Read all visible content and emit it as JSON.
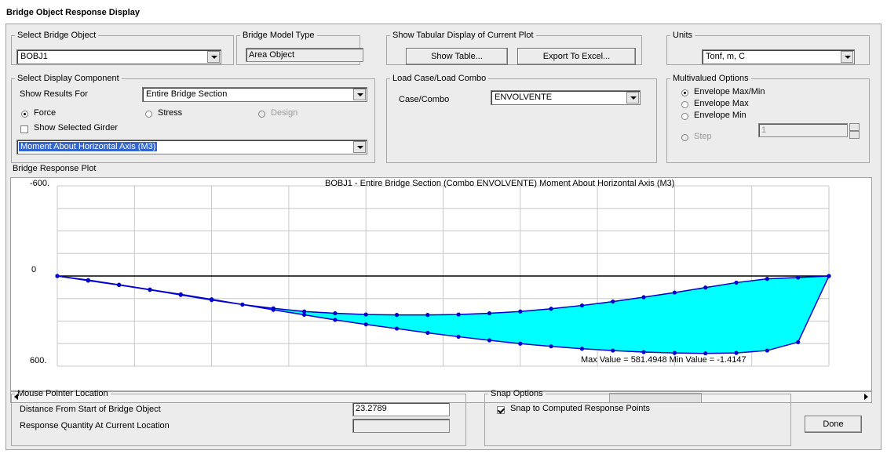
{
  "window": {
    "title": "Bridge Object Response Display"
  },
  "select_bridge_object": {
    "legend": "Select Bridge Object",
    "value": "BOBJ1"
  },
  "bridge_model_type": {
    "legend": "Bridge Model Type",
    "value": "Area Object"
  },
  "tabular": {
    "legend": "Show Tabular Display of Current Plot",
    "show_table": "Show Table...",
    "export": "Export To Excel..."
  },
  "units": {
    "legend": "Units",
    "value": "Tonf, m, C"
  },
  "display_component": {
    "legend": "Select Display Component",
    "show_results_label": "Show Results For",
    "show_results_value": "Entire Bridge Section",
    "force": "Force",
    "stress": "Stress",
    "design": "Design",
    "show_selected_girder": "Show Selected Girder",
    "component_value": "Moment About Horizontal Axis  (M3)"
  },
  "load_case": {
    "legend": "Load Case/Load Combo",
    "label": "Case/Combo",
    "value": "ENVOLVENTE"
  },
  "multivalued": {
    "legend": "Multivalued Options",
    "opt1": "Envelope Max/Min",
    "opt2": "Envelope Max",
    "opt3": "Envelope Min",
    "opt4": "Step",
    "step_value": "1",
    "selected": "Envelope Max/Min"
  },
  "plot": {
    "legend": "Bridge Response Plot",
    "header": "BOBJ1 - Entire Bridge Section  (Combo ENVOLVENTE)  Moment About Horizontal Axis  (M3)",
    "y_top": "-600.",
    "y_mid": "0",
    "y_bottom": "600.",
    "footer": "Max Value = 581.4948    Min Value = -1.4147",
    "fill_color": "#00ffff",
    "line_color": "#0000cc"
  },
  "chart_data": {
    "type": "area",
    "ylim": [
      -600,
      600
    ],
    "y_inverted": true,
    "x": [
      0,
      1,
      2,
      3,
      4,
      5,
      6,
      7,
      8,
      9,
      10,
      11,
      12,
      13,
      14,
      15,
      16,
      17,
      18,
      19,
      20,
      21,
      22,
      23,
      24,
      25
    ],
    "series": [
      {
        "values": [
          0,
          27,
          58,
          90,
          122,
          155,
          190,
          225,
          258,
          292,
          322,
          350,
          378,
          404,
          428,
          450,
          468,
          484,
          496,
          506,
          512,
          515,
          512,
          496,
          440,
          0
        ]
      },
      {
        "values": [
          0,
          31,
          60,
          92,
          126,
          160,
          190,
          215,
          236,
          248,
          256,
          259,
          259,
          256,
          248,
          236,
          218,
          196,
          170,
          141,
          110,
          77,
          44,
          19,
          10,
          0
        ]
      }
    ]
  },
  "mouse_pointer": {
    "legend": "Mouse Pointer Location",
    "distance_label": "Distance From Start of Bridge Object",
    "distance_value": "23.2789",
    "response_label": "Response Quantity At Current Location"
  },
  "snap": {
    "legend": "Snap Options",
    "label": "Snap to Computed Response Points"
  },
  "done": "Done"
}
